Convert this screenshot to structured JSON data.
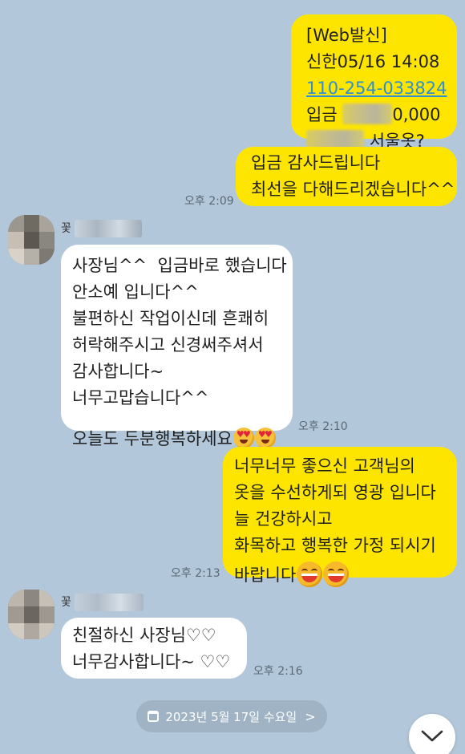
{
  "messages": {
    "m1": {
      "lines": [
        "[Web발신]",
        "신한05/16 14:08",
        "110-254-033824",
        "입금",
        "0,000",
        "서울옷?"
      ]
    },
    "m2": {
      "lines": [
        "입금 감사드립니다",
        "최선을 다해드리겠습니다^^"
      ],
      "time": "오후 2:09"
    },
    "m3": {
      "sender": "꽃",
      "lines": [
        "사장님^^  입금바로 했습니다",
        "안소예 입니다^^",
        "불편하신 작업이신데 흔쾌히",
        "허락해주시고 신경써주셔서",
        "감사합니다~",
        "너무고맙습니다^^",
        "",
        "오늘도 두분행복하세요"
      ],
      "time": "오후 2:10",
      "emoji": "smiling-face-with-heart-eyes-icon"
    },
    "m4": {
      "lines": [
        "너무너무 좋으신 고객님의",
        "옷을 수선하게되 영광 입니다",
        "늘 건강하시고",
        "화목하고 행복한 가정 되시기",
        "바랍니다"
      ],
      "time": "오후 2:13",
      "emoji": "grinning-squinting-face-icon"
    },
    "m5": {
      "sender": "꽃",
      "lines": [
        "친절하신 사장님♡♡",
        "너무감사합니다~ ♡♡"
      ],
      "time": "오후 2:16"
    }
  },
  "date_divider": {
    "label": "2023년 5월 17일 수요일",
    "chevron": ">"
  },
  "scroll_button": {
    "icon": "chevron-down-icon"
  },
  "colors": {
    "background": "#b2c7d9",
    "outgoing_bubble": "#fee500",
    "incoming_bubble": "#ffffff",
    "link": "#2f8fd1",
    "date_pill": "#9fb3c5"
  }
}
